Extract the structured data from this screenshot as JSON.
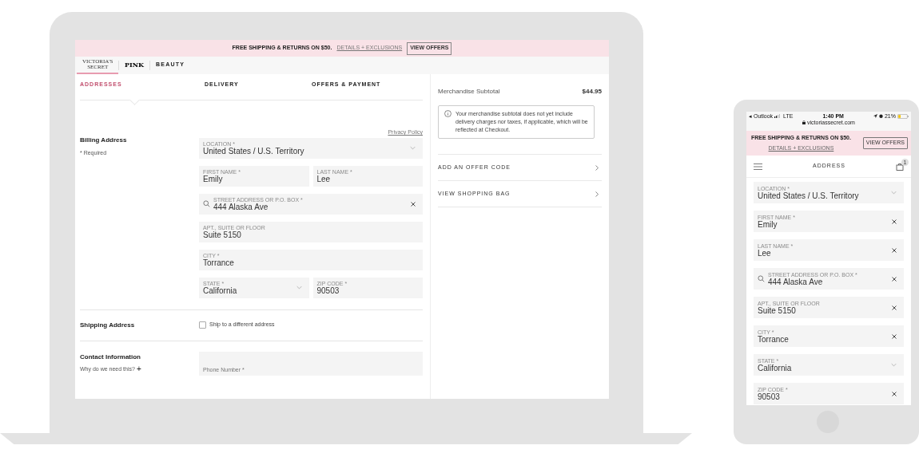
{
  "laptop": {
    "promo": {
      "text": "FREE SHIPPING & RETURNS ON $50.",
      "link": "DETAILS + EXCLUSIONS",
      "button": "VIEW OFFERS"
    },
    "brands": [
      {
        "label": "VICTORIA'S SECRET",
        "kind": "serif",
        "selected": true
      },
      {
        "label": "PINK",
        "kind": "bold",
        "selected": false
      },
      {
        "label": "BEAUTY",
        "kind": "spaced",
        "selected": false
      }
    ],
    "steps": [
      {
        "label": "ADDRESSES",
        "selected": true
      },
      {
        "label": "DELIVERY",
        "selected": false
      },
      {
        "label": "OFFERS & PAYMENT",
        "selected": false
      }
    ],
    "billing": {
      "title": "Billing Address",
      "required": "* Required",
      "privacy": "Privacy Policy",
      "rows": [
        {
          "fields": [
            {
              "kind": "select",
              "label": "LOCATION *",
              "value": "United States / U.S. Territory",
              "clearable": false
            }
          ]
        },
        {
          "fields": [
            {
              "kind": "text",
              "label": "FIRST NAME *",
              "value": "Emily",
              "clearable": false
            },
            {
              "kind": "text",
              "label": "LAST NAME *",
              "value": "Lee",
              "clearable": false
            }
          ]
        },
        {
          "fields": [
            {
              "kind": "search",
              "label": "STREET ADDRESS OR P.O. BOX *",
              "value": "444 Alaska Ave",
              "clearable": true
            }
          ]
        },
        {
          "fields": [
            {
              "kind": "text",
              "label": "APT., SUITE OR FLOOR",
              "value": "Suite 5150",
              "clearable": false
            }
          ]
        },
        {
          "fields": [
            {
              "kind": "text",
              "label": "CITY *",
              "value": "Torrance",
              "clearable": false
            }
          ]
        },
        {
          "fields": [
            {
              "kind": "select",
              "label": "STATE *",
              "value": "California",
              "clearable": false
            },
            {
              "kind": "text",
              "label": "ZIP CODE *",
              "value": "90503",
              "clearable": false
            }
          ]
        }
      ]
    },
    "shipping": {
      "title": "Shipping Address",
      "checkbox": {
        "label": "Ship to a different address",
        "checked": false
      }
    },
    "contact": {
      "title": "Contact Information",
      "why": "Why do we need this?",
      "expander": "+",
      "phone_placeholder": "Phone Number *"
    },
    "summary": {
      "label": "Merchandise Subtotal",
      "value": "$44.95",
      "note": "Your merchandise subtotal does not yet include delivery charges nor taxes, if applicable, which will be reflected at Checkout.",
      "links": [
        "ADD AN OFFER CODE",
        "VIEW SHOPPING BAG"
      ]
    }
  },
  "phone": {
    "status": {
      "back": "◂ Outlook",
      "network": "LTE",
      "time": "1:40 PM",
      "battery": "21%",
      "url": "victoriassecret.com"
    },
    "promo": {
      "text": "FREE SHIPPING & RETURNS ON $50.",
      "link": "DETAILS + EXCLUSIONS",
      "button": "VIEW OFFERS"
    },
    "title": "ADDRESS",
    "bag_count": "1",
    "fields": [
      {
        "kind": "select",
        "label": "LOCATION *",
        "value": "United States / U.S. Territory",
        "clearable": false
      },
      {
        "kind": "text",
        "label": "FIRST NAME *",
        "value": "Emily",
        "clearable": true
      },
      {
        "kind": "text",
        "label": "LAST NAME *",
        "value": "Lee",
        "clearable": true
      },
      {
        "kind": "search",
        "label": "STREET ADDRESS OR P.O. BOX *",
        "value": "444 Alaska Ave",
        "clearable": true
      },
      {
        "kind": "text",
        "label": "APT., SUITE OR FLOOR",
        "value": "Suite 5150",
        "clearable": true
      },
      {
        "kind": "text",
        "label": "CITY *",
        "value": "Torrance",
        "clearable": true
      },
      {
        "kind": "select",
        "label": "STATE *",
        "value": "California",
        "clearable": false
      },
      {
        "kind": "text",
        "label": "ZIP CODE *",
        "value": "90503",
        "clearable": true
      }
    ]
  }
}
